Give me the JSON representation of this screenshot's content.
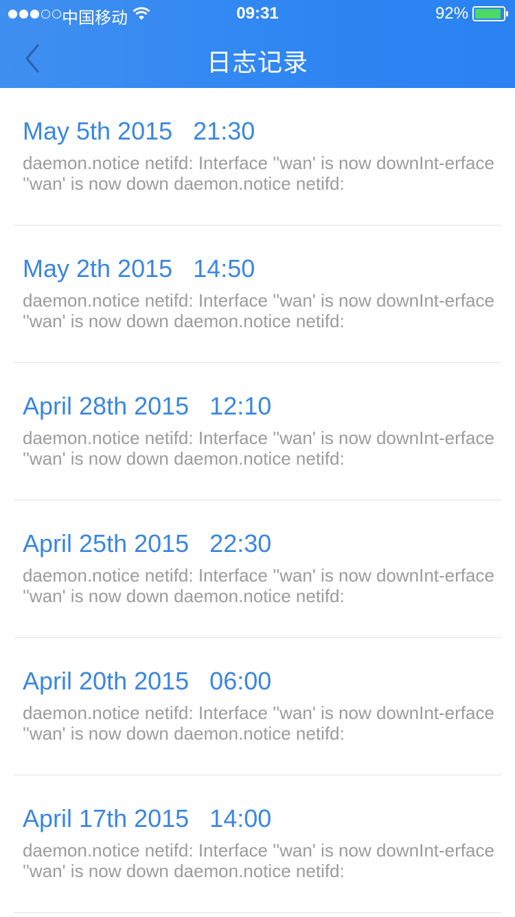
{
  "status_bar": {
    "carrier": "中国移动",
    "time": "09:31",
    "battery": "92%",
    "battery_level": 0.92,
    "signal_bars_filled": 3,
    "signal_bars_total": 5
  },
  "nav": {
    "back_icon": "chevron-left-icon",
    "title": "日志记录"
  },
  "colors": {
    "header": "#2f86f2",
    "timestamp": "#3a86e0",
    "message": "#9b9b9b",
    "battery": "#4cd964"
  },
  "logs": [
    {
      "timestamp": "May 5th 2015   21:30",
      "message": "daemon.notice netifd: Interface ''wan' is now downInt-erface ''wan' is now down daemon.notice netifd:"
    },
    {
      "timestamp": "May 2th 2015   14:50",
      "message": "daemon.notice netifd: Interface ''wan' is now downInt-erface ''wan' is now down daemon.notice netifd:"
    },
    {
      "timestamp": "April 28th 2015   12:10",
      "message": "daemon.notice netifd: Interface ''wan' is now downInt-erface ''wan' is now down daemon.notice netifd:"
    },
    {
      "timestamp": "April 25th 2015   22:30",
      "message": "daemon.notice netifd: Interface ''wan' is now downInt-erface ''wan' is now down daemon.notice netifd:"
    },
    {
      "timestamp": "April 20th 2015   06:00",
      "message": "daemon.notice netifd: Interface ''wan' is now downInt-erface ''wan' is now down daemon.notice netifd:"
    },
    {
      "timestamp": "April 17th 2015   14:00",
      "message": "daemon.notice netifd: Interface ''wan' is now downInt-erface ''wan' is now down daemon.notice netifd:"
    }
  ]
}
